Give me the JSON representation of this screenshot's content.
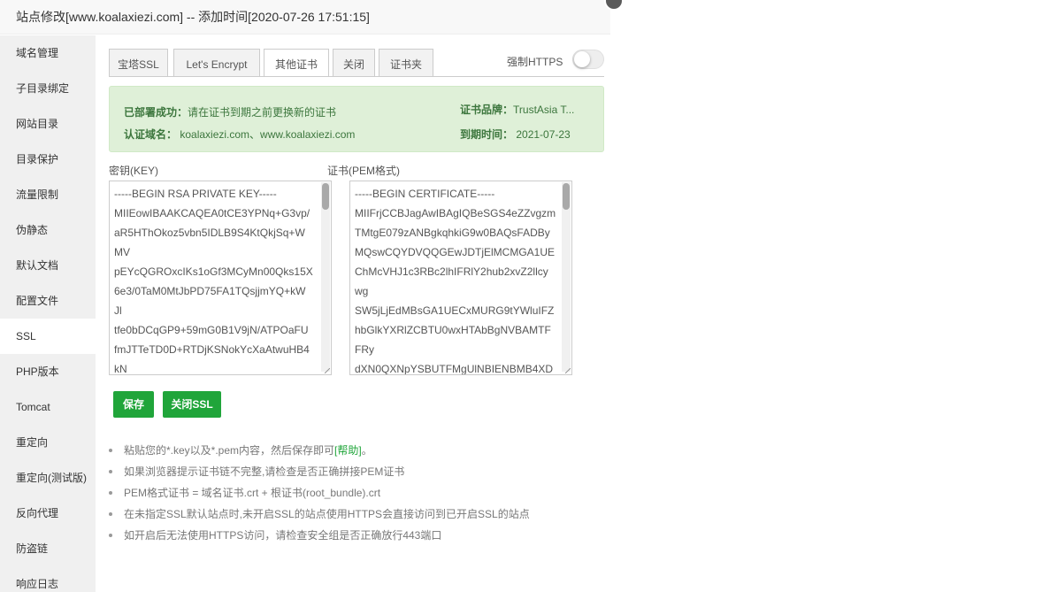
{
  "title": "站点修改[www.koalaxiezi.com] -- 添加时间[2020-07-26 17:51:15]",
  "sidebar": {
    "items": [
      {
        "label": "域名管理"
      },
      {
        "label": "子目录绑定"
      },
      {
        "label": "网站目录"
      },
      {
        "label": "目录保护"
      },
      {
        "label": "流量限制"
      },
      {
        "label": "伪静态"
      },
      {
        "label": "默认文档"
      },
      {
        "label": "配置文件"
      },
      {
        "label": "SSL"
      },
      {
        "label": "PHP版本"
      },
      {
        "label": "Tomcat"
      },
      {
        "label": "重定向"
      },
      {
        "label": "重定向(测试版)"
      },
      {
        "label": "反向代理"
      },
      {
        "label": "防盗链"
      },
      {
        "label": "响应日志"
      }
    ],
    "active": "SSL"
  },
  "tabs": [
    {
      "label": "宝塔SSL"
    },
    {
      "label": "Let's Encrypt"
    },
    {
      "label": "其他证书"
    },
    {
      "label": "关闭"
    },
    {
      "label": "证书夹"
    }
  ],
  "active_tab": "其他证书",
  "force_https": {
    "label": "强制HTTPS",
    "enabled": false
  },
  "alert": {
    "status_label": "已部署成功：",
    "status_text": "请在证书到期之前更换新的证书",
    "domain_label": "认证域名：",
    "domain_value": " koalaxiezi.com、www.koalaxiezi.com",
    "brand_label": "证书品牌：",
    "brand_value": "TrustAsia T...",
    "expire_label": "到期时间：",
    "expire_value": " 2021-07-23"
  },
  "key_label": "密钥(KEY)",
  "cert_label": "证书(PEM格式)",
  "key_lines": [
    "-----BEGIN RSA PRIVATE KEY-----",
    "MIIEowIBAAKCAQEA0tCE3YPNq+G3vp/",
    "aR5HThOkoz5vbn5IDLB9S4KtQkjSq+W",
    "MV",
    "pEYcQGROxcIKs1oGf3MCyMn00Qks15X",
    "6e3/0TaM0MtJbPD75FA1TQsjjmYQ+kW",
    "Jl",
    "tfe0bDCqGP9+59mG0B1V9jN/ATPOaFU",
    "fmJTTeTD0D+RTDjKSNokYcXaAtwuHB4",
    "kN"
  ],
  "cert_lines": [
    "-----BEGIN CERTIFICATE-----",
    "MIIFrjCCBJagAwIBAgIQBeSGS4eZZvgzm",
    "TMtgE079zANBgkqhkiG9w0BAQsFADBy",
    "MQswCQYDVQQGEwJDTjElMCMGA1UE",
    "ChMcVHJ1c3RBc2lhIFRlY2hub2xvZ2llcy",
    "wg",
    "SW5jLjEdMBsGA1UECxMURG9tYWluIFZ",
    "hbGlkYXRlZCBTU0wxHTAbBgNVBAMTF",
    "FRy",
    "dXN0QXNpYSBUTFMgUlNBIENBMB4XD"
  ],
  "buttons": {
    "save": "保存",
    "close_ssl": "关闭SSL"
  },
  "tips": [
    {
      "text": "粘贴您的*.key以及*.pem内容，然后保存即可",
      "link": "[帮助]",
      "suffix": "。"
    },
    {
      "text": "如果浏览器提示证书链不完整,请检查是否正确拼接PEM证书"
    },
    {
      "text": "PEM格式证书 = 域名证书.crt + 根证书(root_bundle).crt"
    },
    {
      "text": "在未指定SSL默认站点时,未开启SSL的站点使用HTTPS会直接访问到已开启SSL的站点"
    },
    {
      "text": "如开启后无法使用HTTPS访问，请检查安全组是否正确放行443端口"
    }
  ],
  "colors": {
    "accent": "#20a53a",
    "alert_bg": "#dff0d8",
    "alert_text": "#3c763d"
  }
}
